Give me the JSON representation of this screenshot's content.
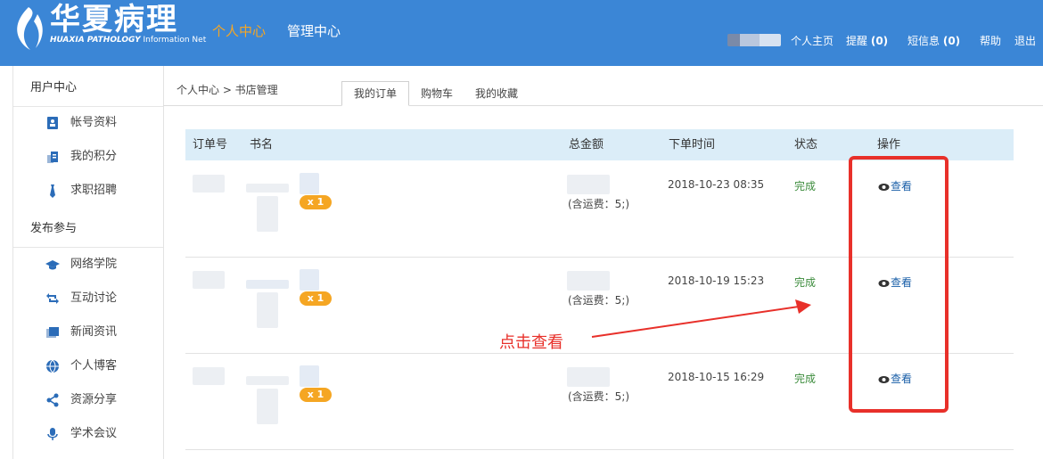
{
  "header": {
    "logo_cn": "华夏病理",
    "logo_en_bold": "HUAXIA PATHOLOGY",
    "logo_en_rest": "Information Net",
    "nav": [
      "个人中心",
      "管理中心"
    ],
    "links": {
      "home": "个人主页",
      "remind_label": "提醒",
      "remind_count": "(0)",
      "msg_label": "短信息",
      "msg_count": "(0)",
      "help": "帮助",
      "logout": "退出"
    },
    "colors": {
      "bar": "#3b86d6",
      "active_nav": "#f6a623"
    }
  },
  "sidebar": {
    "sections": [
      {
        "title": "用户中心",
        "items": [
          {
            "label": "帐号资料",
            "icon": "id-card-icon"
          },
          {
            "label": "我的积分",
            "icon": "coins-icon"
          },
          {
            "label": "求职招聘",
            "icon": "tie-icon"
          }
        ]
      },
      {
        "title": "发布参与",
        "items": [
          {
            "label": "网络学院",
            "icon": "graduation-cap-icon"
          },
          {
            "label": "互动讨论",
            "icon": "retweet-icon"
          },
          {
            "label": "新闻资讯",
            "icon": "newspaper-icon"
          },
          {
            "label": "个人博客",
            "icon": "globe-icon"
          },
          {
            "label": "资源分享",
            "icon": "share-icon"
          },
          {
            "label": "学术会议",
            "icon": "microphone-icon"
          }
        ]
      }
    ]
  },
  "breadcrumb": "个人中心 > 书店管理",
  "tabs": [
    "我的订单",
    "购物车",
    "我的收藏"
  ],
  "table": {
    "headers": [
      "订单号",
      "书名",
      "总金额",
      "下单时间",
      "状态",
      "操作"
    ],
    "rows": [
      {
        "qty": "x 1",
        "shipping": "(含运费：5;)",
        "time": "2018-10-23 08:35",
        "status": "完成",
        "action": "查看"
      },
      {
        "qty": "x 1",
        "shipping": "(含运费：5;)",
        "time": "2018-10-19 15:23",
        "status": "完成",
        "action": "查看"
      },
      {
        "qty": "x 1",
        "shipping": "(含运费：5;)",
        "time": "2018-10-15 16:29",
        "status": "完成",
        "action": "查看"
      }
    ]
  },
  "annotation": {
    "text": "点击查看",
    "color": "#e8302a"
  }
}
